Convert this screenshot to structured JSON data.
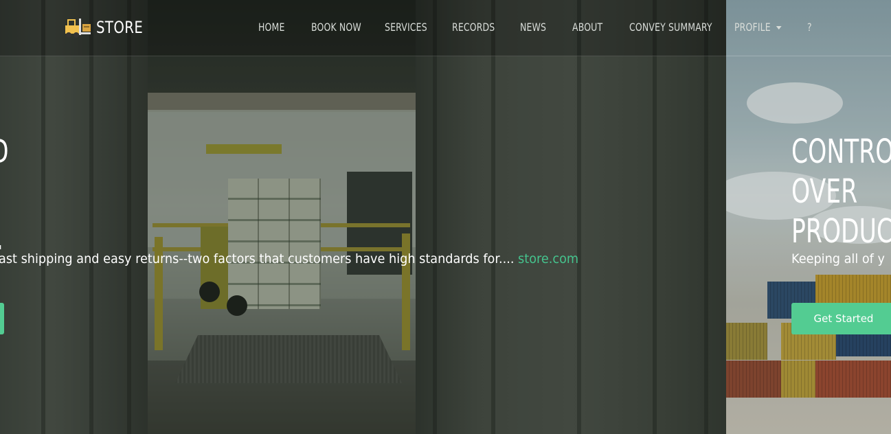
{
  "brand": {
    "name": "STORE",
    "logo_icon": "forklift-icon"
  },
  "nav": {
    "items": [
      {
        "label": "HOME"
      },
      {
        "label": "BOOK NOW"
      },
      {
        "label": "SERVICES"
      },
      {
        "label": "RECORDS"
      },
      {
        "label": "NEWS"
      },
      {
        "label": "ABOUT"
      },
      {
        "label": "CONVEY SUMMARY"
      },
      {
        "label": "PROFILE",
        "has_dropdown": true
      },
      {
        "label": "?"
      }
    ]
  },
  "slides": {
    "current": {
      "title_line1": "D",
      "title_line2": ".",
      "text": "ast shipping and easy returns--two factors that customers have high standards for....",
      "link": "store.com",
      "button_label": ""
    },
    "next": {
      "title": "CONTRO\nOVER\nPRODUC",
      "text": "Keeping all of y",
      "button_label": "Get Started"
    }
  },
  "colors": {
    "accent": "#53cc92",
    "link": "#45c48e",
    "nav_text": "#d9ddd9"
  }
}
